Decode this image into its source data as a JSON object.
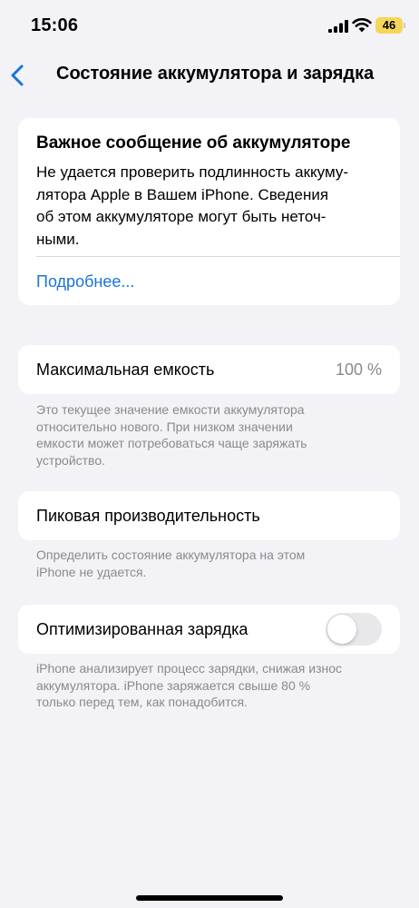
{
  "status_bar": {
    "time": "15:06",
    "battery_level": "46",
    "battery_color": "#f6d65a"
  },
  "nav": {
    "back_icon": "chevron-left-icon",
    "title": "Состояние аккумулятора и зарядка"
  },
  "battery_alert": {
    "title": "Важное сообщение об аккумуляторе",
    "body_lines": [
      "Не удается проверить подлинность аккуму-",
      "лятора Apple в Вашем iPhone. Сведения",
      "об этом аккумуляторе могут быть неточ-",
      "ными."
    ],
    "link": "Подробнее..."
  },
  "max_capacity": {
    "label": "Максимальная емкость",
    "value": "100 %",
    "footnote_lines": [
      "Это текущее значение емкости аккумулятора",
      "относительно нового. При низком значении",
      "емкости может потребоваться чаще заряжать",
      "устройство."
    ]
  },
  "peak_performance": {
    "label": "Пиковая производительность",
    "footnote_lines": [
      "Определить состояние аккумулятора на этом",
      "iPhone не удается."
    ]
  },
  "optimized_charging": {
    "label": "Оптимизированная зарядка",
    "enabled": false,
    "footnote_lines": [
      "iPhone анализирует процесс зарядки, снижая износ",
      "аккумулятора. iPhone заряжается свыше 80 %",
      "только перед тем, как понадобится."
    ]
  },
  "colors": {
    "accent": "#1a73d9",
    "background": "#f2f2f7",
    "secondary_text": "#8a8a8e"
  }
}
